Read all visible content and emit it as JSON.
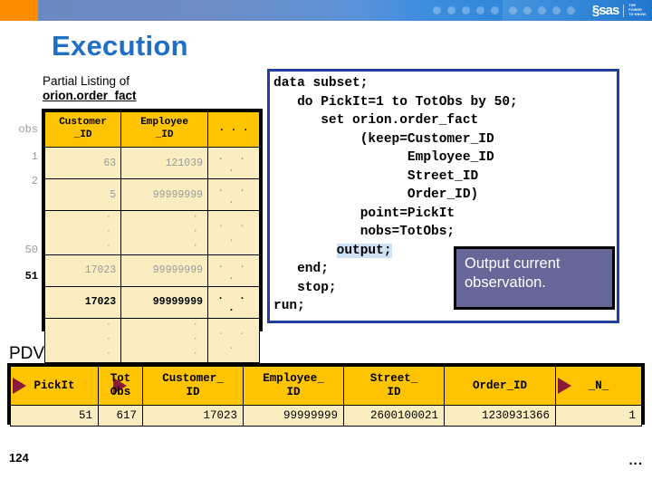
{
  "banner": {
    "logo_text": "§sas",
    "tagline_line1": "THE",
    "tagline_line2": "POWER",
    "tagline_line3": "TO KNOW.",
    "accent_orange": "#FF8C00",
    "accent_blue": "#2278CF"
  },
  "slide": {
    "title": "Execution",
    "page_number": "124",
    "ellipsis": "..."
  },
  "listing": {
    "caption_line1": "Partial Listing of",
    "caption_line2": "orion.order_fact",
    "obs_header": "obs",
    "columns": [
      {
        "line1": "Customer",
        "line2": "_ID"
      },
      {
        "line1": "Employee",
        "line2": "_ID"
      },
      {
        "line1": ".  .  .",
        "line2": ""
      }
    ],
    "rows": [
      {
        "obs": "1",
        "customer_id": "63",
        "employee_id": "121039",
        "more": ".  .  .",
        "highlight": false,
        "dots": false
      },
      {
        "obs": "2",
        "customer_id": "5",
        "employee_id": "99999999",
        "more": ".  .  .",
        "highlight": false,
        "dots": false
      },
      {
        "obs": "",
        "customer_id": "·\n·\n·",
        "employee_id": "·\n·\n·",
        "more": ".  .  .",
        "highlight": false,
        "dots": true
      },
      {
        "obs": "50",
        "customer_id": "17023",
        "employee_id": "99999999",
        "more": ".  .  .",
        "highlight": false,
        "dots": false
      },
      {
        "obs": "51",
        "customer_id": "17023",
        "employee_id": "99999999",
        "more": ".  .  .",
        "highlight": true,
        "dots": false
      },
      {
        "obs": "",
        "customer_id": "·\n·\n·",
        "employee_id": "·\n·\n·",
        "more": ".  .  .",
        "highlight": false,
        "dots": true
      }
    ]
  },
  "code": {
    "before_highlight": "data subset;\n   do PickIt=1 to TotObs by 50;\n      set orion.order_fact\n           (keep=Customer_ID\n                 Employee_ID\n                 Street_ID\n                 Order_ID)\n           point=PickIt\n           nobs=TotObs;\n        ",
    "highlight": "output;",
    "after_highlight": "\n   end;\n   stop;\nrun;",
    "highlight_color": "#CFE2F3"
  },
  "callout": {
    "text": "Output current observation.",
    "background": "#666699"
  },
  "pdv": {
    "label": "PDV",
    "columns": [
      {
        "line1": "PickIt",
        "line2": "",
        "arrow": "left",
        "value": "51"
      },
      {
        "line1": "Tot",
        "line2": "Obs",
        "arrow": "mid",
        "value": "617"
      },
      {
        "line1": "Customer_",
        "line2": "ID",
        "arrow": "none",
        "value": "17023"
      },
      {
        "line1": "Employee_",
        "line2": "ID",
        "arrow": "none",
        "value": "99999999"
      },
      {
        "line1": "Street_",
        "line2": "ID",
        "arrow": "none",
        "value": "2600100021"
      },
      {
        "line1": "Order_ID",
        "line2": "",
        "arrow": "none",
        "value": "1230931366"
      },
      {
        "line1": "_N_",
        "line2": "",
        "arrow": "left",
        "value": "1"
      }
    ]
  }
}
